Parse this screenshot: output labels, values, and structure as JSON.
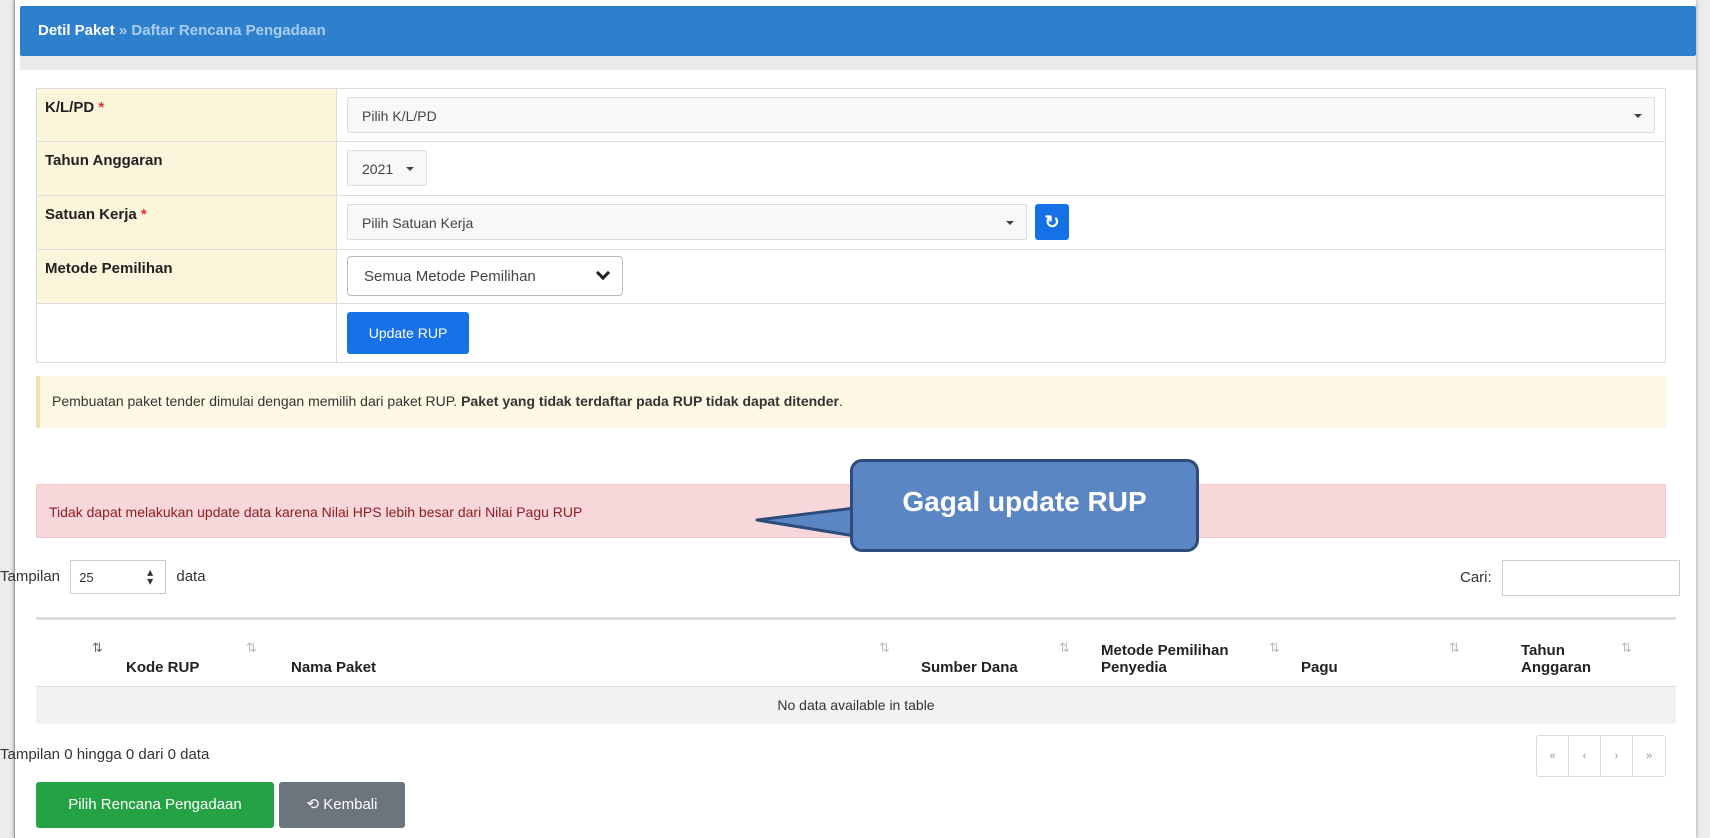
{
  "breadcrumb": {
    "current": "Detil Paket",
    "separator": "»",
    "sub": "Daftar Rencana Pengadaan"
  },
  "form": {
    "klpd": {
      "label": "K/L/PD",
      "required": "*",
      "value": "Pilih K/L/PD"
    },
    "tahun": {
      "label": "Tahun Anggaran",
      "value": "2021"
    },
    "satker": {
      "label": "Satuan Kerja",
      "required": "*",
      "value": "Pilih Satuan Kerja",
      "refresh_icon": "↻"
    },
    "metode": {
      "label": "Metode Pemilihan",
      "value": "Semua Metode Pemilihan"
    },
    "update_button": "Update RUP"
  },
  "alerts": {
    "info_text": "Pembuatan paket tender dimulai dengan memilih dari paket RUP.",
    "info_bold": "Paket yang tidak terdaftar pada RUP tidak dapat ditender",
    "info_end": ".",
    "error_text": "Tidak dapat melakukan update data karena Nilai HPS lebih besar dari Nilai Pagu RUP"
  },
  "callout": {
    "text": "Gagal update RUP"
  },
  "datatable": {
    "length_prefix": "Tampilan",
    "length_value": "25",
    "length_suffix": "data",
    "search_label": "Cari:",
    "sort_icon": "⇅",
    "columns": {
      "kode": "Kode RUP",
      "nama": "Nama Paket",
      "sumber": "Sumber Dana",
      "metode_1": "Metode Pemilihan",
      "metode_2": "Penyedia",
      "pagu": "Pagu",
      "tahun_1": "Tahun",
      "tahun_2": "Anggaran"
    },
    "empty_text": "No data available in table",
    "info": "Tampilan 0 hingga 0 dari 0 data",
    "pager": [
      "«",
      "‹",
      "›",
      "»"
    ]
  },
  "actions": {
    "pilih": "Pilih Rencana Pengadaan",
    "kembali_icon": "⟲",
    "kembali": "Kembali"
  },
  "colors": {
    "header": "#2f80cc",
    "primary": "#1670e6",
    "success": "#25a244",
    "secondary": "#6c757d",
    "danger_bg": "#f8d7da",
    "warning_bg": "#fcf8e3",
    "callout": "#5a86c4"
  }
}
